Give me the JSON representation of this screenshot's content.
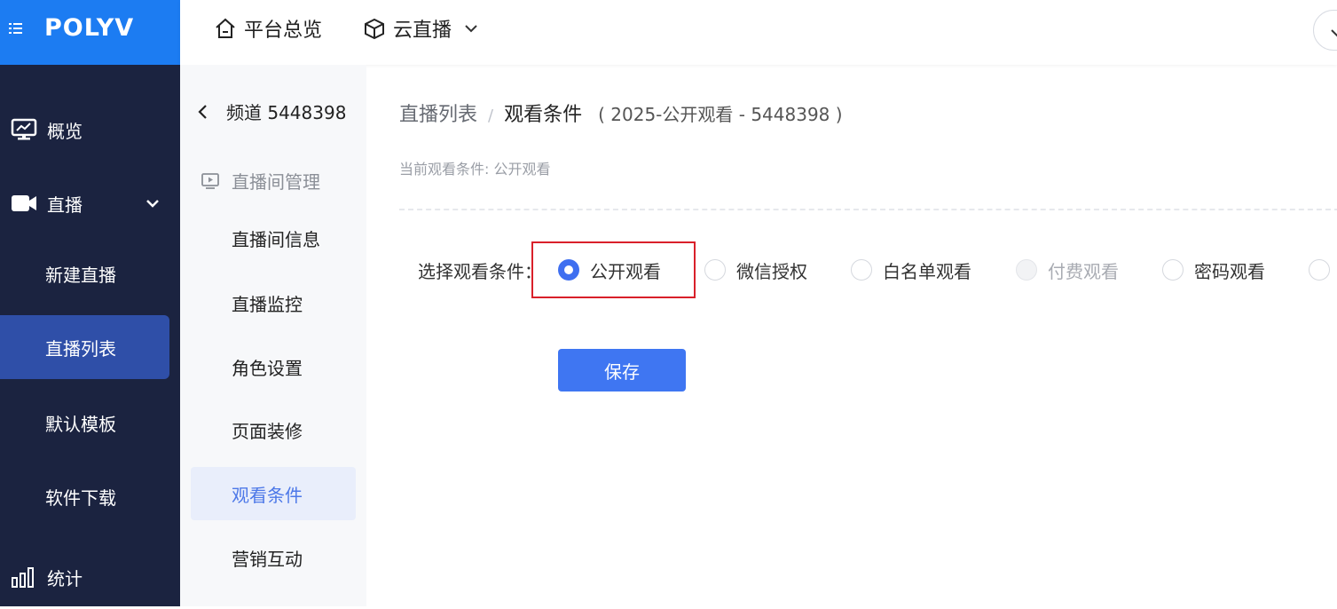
{
  "brand": {
    "logo": "POLYV",
    "bar_color": "#1c7cf2"
  },
  "top_nav": {
    "overview": "平台总览",
    "product": "云直播"
  },
  "left_nav": {
    "items": [
      {
        "label": "概览",
        "icon": "monitor-icon"
      },
      {
        "label": "直播",
        "icon": "video-camera-icon"
      },
      {
        "label": "新建直播"
      },
      {
        "label": "直播列表"
      },
      {
        "label": "默认模板"
      },
      {
        "label": "软件下载"
      },
      {
        "label": "统计",
        "icon": "bar-chart-icon"
      }
    ]
  },
  "sub_nav": {
    "back_label": "频道 5448398",
    "group_label": "直播间管理",
    "items": [
      "直播间信息",
      "直播监控",
      "角色设置",
      "页面装修",
      "观看条件",
      "营销互动"
    ]
  },
  "main": {
    "breadcrumb": {
      "parent": "直播列表",
      "sep": "/",
      "current": "观看条件",
      "extra": "( 2025-公开观看 - 5448398 )"
    },
    "current_condition": "当前观看条件: 公开观看",
    "condition_label": "选择观看条件：",
    "options": [
      {
        "label": "公开观看",
        "state": "checked"
      },
      {
        "label": "微信授权",
        "state": "normal"
      },
      {
        "label": "白名单观看",
        "state": "normal"
      },
      {
        "label": "付费观看",
        "state": "disabled"
      },
      {
        "label": "密码观看",
        "state": "normal"
      }
    ],
    "save_label": "保存"
  },
  "colors": {
    "accent": "#3f76f2",
    "sidebar": "#1b2340",
    "active_nav": "#2f4fa8",
    "highlight": "#d9202a"
  }
}
